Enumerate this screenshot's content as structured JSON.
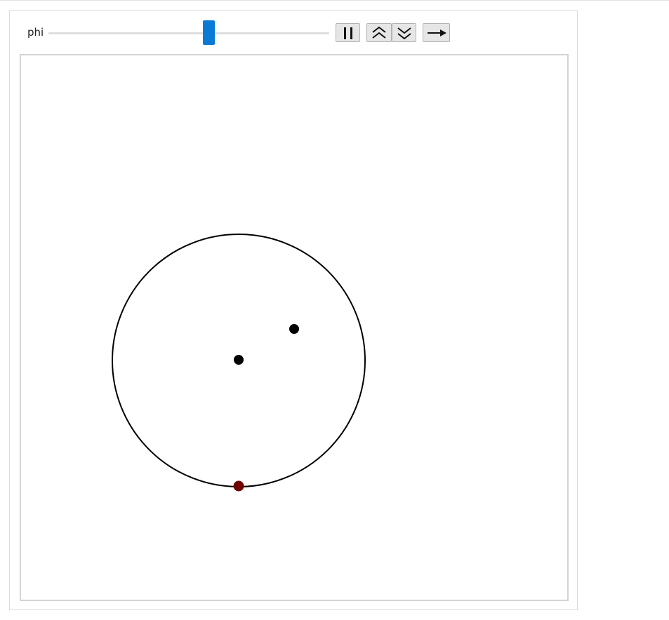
{
  "controls": {
    "parameter_label": "phi",
    "slider_value_fraction": 0.57,
    "buttons": [
      {
        "name": "pause-button",
        "icon": "pause-icon"
      },
      {
        "name": "faster-button",
        "icon": "double-chevron-up-icon"
      },
      {
        "name": "slower-button",
        "icon": "double-chevron-down-icon"
      },
      {
        "name": "direction-button",
        "icon": "arrow-right-icon"
      }
    ]
  },
  "plot": {
    "circle_color": "#000000",
    "point_color": "#000000",
    "moving_point_color": "#6e0000"
  }
}
